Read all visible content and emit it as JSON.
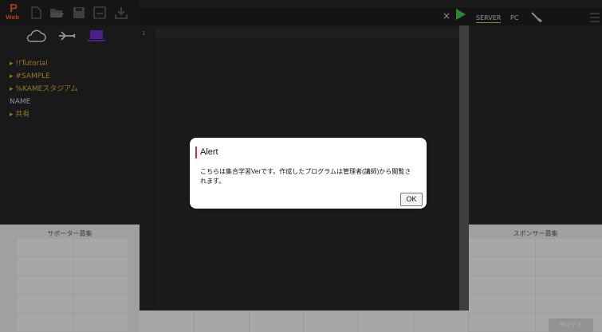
{
  "app": {
    "logo_text": "P",
    "logo_subtext": "Web",
    "brand_color": "#e05a22"
  },
  "toolbar": {
    "icons": [
      "new-file-icon",
      "open-folder-icon",
      "save-icon",
      "save-as-icon",
      "download-icon"
    ]
  },
  "location_icons": [
    "cloud-icon",
    "airplane-icon",
    "laptop-icon"
  ],
  "file_tree": {
    "items": [
      {
        "label": "!!Tutorial",
        "folder": true
      },
      {
        "label": "#SAMPLE",
        "folder": true
      },
      {
        "label": "%KAMEスタジアム",
        "folder": true
      },
      {
        "label": "NAME",
        "folder": false
      },
      {
        "label": "共有",
        "folder": true
      }
    ]
  },
  "left_panel": {
    "grid_title": "サポーター募集"
  },
  "editor": {
    "line_number": "1",
    "close_label": "×"
  },
  "right_panel": {
    "tabs": [
      "SERVER",
      "PC"
    ],
    "grid_title": "スポンサー募集",
    "donate_label": "寄付する"
  },
  "dialog": {
    "title": "Alert",
    "message": "こちらは集合学習Verです。作成したプログラムは管理者(講師)から閲覧されます。",
    "ok_label": "OK",
    "accent_color": "#d32f2f"
  }
}
